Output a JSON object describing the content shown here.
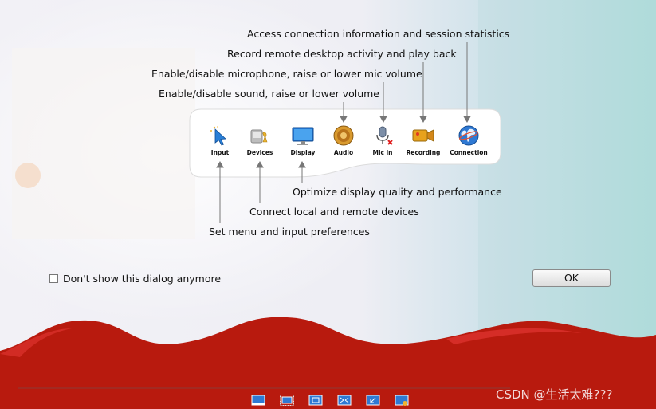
{
  "callouts": {
    "connection": "Access connection information and session statistics",
    "recording": "Record remote desktop activity and play back",
    "mic": "Enable/disable microphone, raise or lower mic volume",
    "audio": "Enable/disable sound, raise or lower volume",
    "display": "Optimize display quality and performance",
    "devices": "Connect local and remote devices",
    "input": "Set menu and input preferences"
  },
  "toolbar": {
    "items": [
      {
        "label": "Input",
        "icon": "cursor-icon"
      },
      {
        "label": "Devices",
        "icon": "devices-icon"
      },
      {
        "label": "Display",
        "icon": "monitor-icon"
      },
      {
        "label": "Audio",
        "icon": "speaker-icon"
      },
      {
        "label": "Mic in",
        "icon": "microphone-muted-icon"
      },
      {
        "label": "Recording",
        "icon": "camera-icon"
      },
      {
        "label": "Connection",
        "icon": "globe-icon"
      }
    ]
  },
  "dialog": {
    "checkbox_label": "Don't show this dialog anymore",
    "checkbox_checked": false,
    "ok_label": "OK"
  },
  "watermark": "CSDN @生活太难???",
  "colors": {
    "wave_red": "#b81a0e",
    "accent_blue": "#2a7fd6"
  }
}
